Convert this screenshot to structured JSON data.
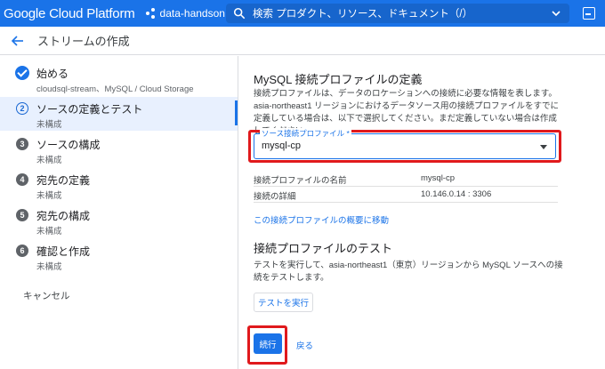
{
  "topbar": {
    "brand": "Google Cloud Platform",
    "project": "data-handson",
    "search_placeholder": "検索  プロダクト、リソース、ドキュメント（/）"
  },
  "header": {
    "title": "ストリームの作成"
  },
  "stepper": {
    "steps": [
      {
        "label": "始める",
        "sub": "cloudsql-stream、MySQL / Cloud Storage",
        "state": "done"
      },
      {
        "number": "2",
        "label": "ソースの定義とテスト",
        "sub": "未構成",
        "state": "active"
      },
      {
        "number": "3",
        "label": "ソースの構成",
        "sub": "未構成"
      },
      {
        "number": "4",
        "label": "宛先の定義",
        "sub": "未構成"
      },
      {
        "number": "5",
        "label": "宛先の構成",
        "sub": "未構成"
      },
      {
        "number": "6",
        "label": "確認と作成",
        "sub": "未構成"
      }
    ],
    "cancel": "キャンセル"
  },
  "main": {
    "section_title": "MySQL 接続プロファイルの定義",
    "description": "接続プロファイルは、データのロケーションへの接続に必要な情報を表します。asia-northeast1 リージョンにおけるデータソース用の接続プロファイルをすでに定義している場合は、以下で選択してください。まだ定義していない場合は作成してください。",
    "select_label": "ソース接続プロファイル *",
    "select_value": "mysql-cp",
    "info_rows": [
      {
        "key": "接続プロファイルの名前",
        "value": "mysql-cp"
      },
      {
        "key": "接続の詳細",
        "value": "10.146.0.14 : 3306"
      }
    ],
    "overview_link": "この接続プロファイルの概要に移動",
    "test_title": "接続プロファイルのテスト",
    "test_description": "テストを実行して、asia-northeast1（東京）リージョンから MySQL ソースへの接続をテストします。",
    "run_test": "テストを実行",
    "continue": "続行",
    "back": "戻る"
  },
  "colors": {
    "accent": "#1a73e8",
    "highlight": "#e0191c"
  }
}
